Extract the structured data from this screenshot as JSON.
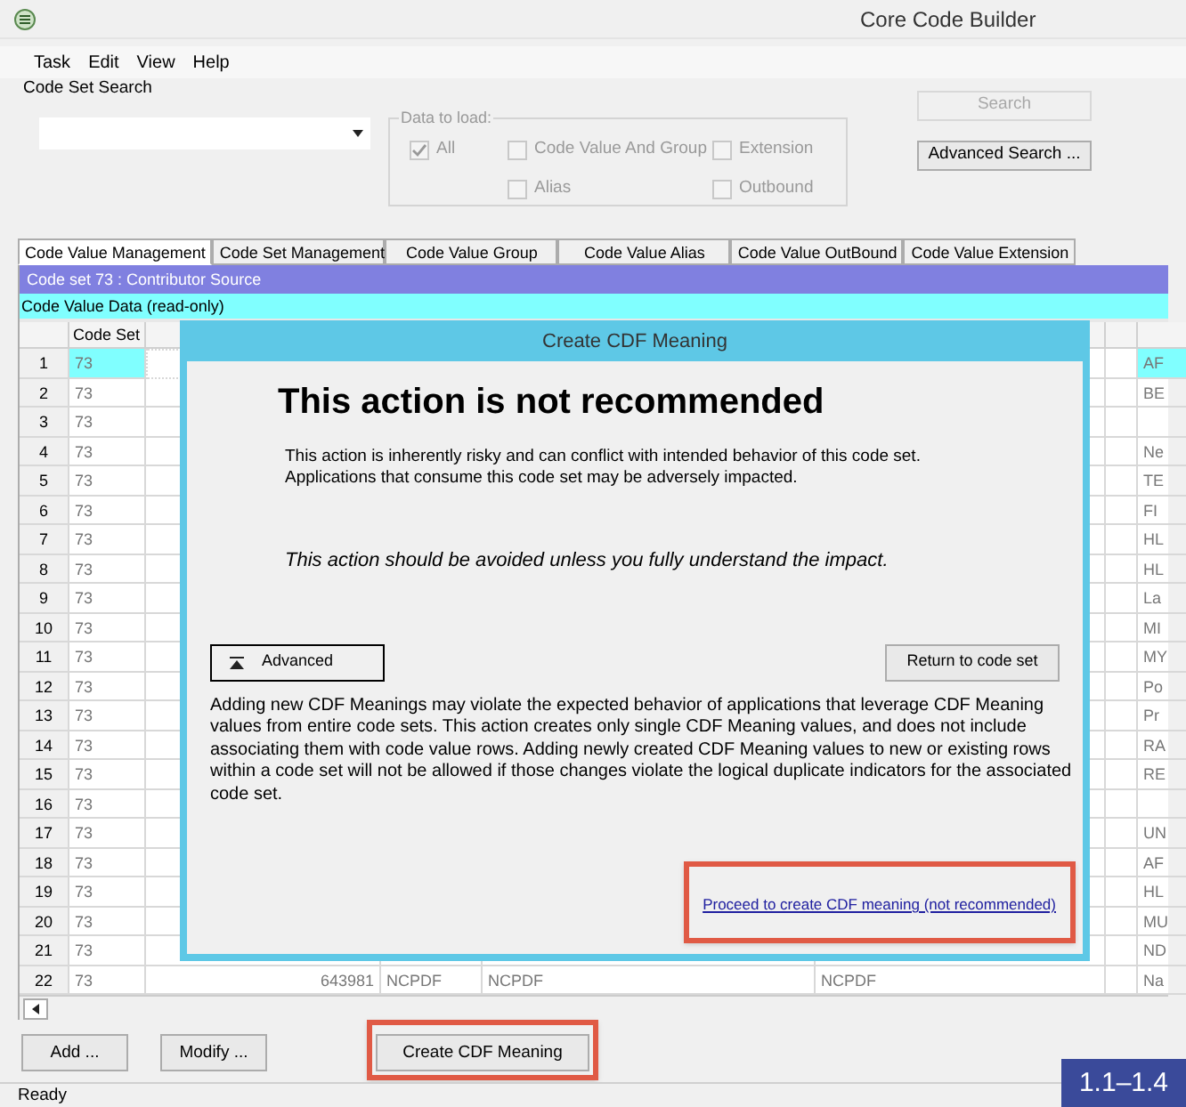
{
  "window": {
    "title": "Core Code Builder"
  },
  "menu": [
    "Task",
    "Edit",
    "View",
    "Help"
  ],
  "search": {
    "label": "Code Set Search",
    "data_to_load": {
      "label": "Data to load:",
      "options": [
        {
          "label": "All",
          "checked": true,
          "disabled": true
        },
        {
          "label": "Code Value And Group",
          "checked": false,
          "disabled": true
        },
        {
          "label": "Extension",
          "checked": false,
          "disabled": true
        },
        {
          "label": "Alias",
          "checked": false,
          "disabled": true
        },
        {
          "label": "Outbound",
          "checked": false,
          "disabled": true
        }
      ]
    },
    "buttons": [
      {
        "label": "Search",
        "disabled": true
      },
      {
        "label": "Advanced Search ...",
        "disabled": false
      }
    ]
  },
  "tabs": [
    {
      "label": "Code Value Management",
      "selected": true
    },
    {
      "label": "Code Set Management",
      "selected": false
    },
    {
      "label": "Code Value Group",
      "selected": false
    },
    {
      "label": "Code Value Alias",
      "selected": false
    },
    {
      "label": "Code Value OutBound",
      "selected": false
    },
    {
      "label": "Code Value Extension",
      "selected": false
    }
  ],
  "code_set_bar": "Code set 73 : Contributor Source",
  "data_bar": "Code Value Data (read-only)",
  "grid": {
    "columns": [
      "Code Set"
    ],
    "rows": [
      {
        "num": "1",
        "code_set": "73",
        "column_8": "AF",
        "selected": true
      },
      {
        "num": "2",
        "code_set": "73",
        "column_8": "BE",
        "selected": false
      },
      {
        "num": "3",
        "code_set": "73",
        "selected": false
      },
      {
        "num": "4",
        "code_set": "73",
        "column_8": "Ne",
        "selected": false
      },
      {
        "num": "5",
        "code_set": "73",
        "column_8": "TE",
        "selected": false
      },
      {
        "num": "6",
        "code_set": "73",
        "column_8": "FI",
        "selected": false
      },
      {
        "num": "7",
        "code_set": "73",
        "column_8": "HL",
        "selected": false
      },
      {
        "num": "8",
        "code_set": "73",
        "column_8": "HL",
        "selected": false
      },
      {
        "num": "9",
        "code_set": "73",
        "column_8": "La",
        "selected": false
      },
      {
        "num": "10",
        "code_set": "73",
        "column_8": "MI",
        "selected": false
      },
      {
        "num": "11",
        "code_set": "73",
        "column_8": "MY",
        "selected": false
      },
      {
        "num": "12",
        "code_set": "73",
        "column_8": "Po",
        "selected": false
      },
      {
        "num": "13",
        "code_set": "73",
        "column_8": "Pr",
        "selected": false
      },
      {
        "num": "14",
        "code_set": "73",
        "column_8": "RA",
        "selected": false
      },
      {
        "num": "15",
        "code_set": "73",
        "column_8": "RE",
        "selected": false
      },
      {
        "num": "16",
        "code_set": "73",
        "selected": false
      },
      {
        "num": "17",
        "code_set": "73",
        "column_8": "UN",
        "selected": false
      },
      {
        "num": "18",
        "code_set": "73",
        "column_8": "AF",
        "selected": false
      },
      {
        "num": "19",
        "code_set": "73",
        "column_8": "HL",
        "selected": false
      },
      {
        "num": "20",
        "code_set": "73",
        "column_8": "MU",
        "selected": false
      },
      {
        "num": "21",
        "code_set": "73",
        "column_8": "ND",
        "selected": false
      },
      {
        "num": "22",
        "code_set": "73",
        "column_3": "643981",
        "column_4": "NCPDF",
        "column_5": "NCPDF",
        "column_6": "NCPDF",
        "column_8": "Na",
        "selected": false
      }
    ]
  },
  "dialog": {
    "title": "Create CDF Meaning",
    "heading": "This action is not recommended",
    "warning": "This action is inherently risky and can conflict with intended behavior of this code set. Applications that consume this code set may be adversely impacted.",
    "caution": "This action should be avoided unless you fully understand the impact.",
    "advanced_button": "Advanced",
    "return_button": "Return to code set",
    "details": "Adding new CDF Meanings may violate the expected behavior of applications that leverage CDF Meaning values from entire code sets.  This action creates only single CDF Meaning values, and does not include associating them with code value rows.  Adding newly created CDF Meaning values to new or existing rows within a code set will not be allowed if those changes violate the logical duplicate indicators for the associated code set.",
    "proceed_link": "Proceed to create CDF meaning (not recommended)",
    "proceed_highlighted": true
  },
  "bottom_buttons": [
    {
      "label": "Add ...",
      "highlighted": false
    },
    {
      "label": "Modify ...",
      "highlighted": false
    },
    {
      "label": "Create CDF Meaning",
      "highlighted": true
    }
  ],
  "status_bar": "Ready",
  "step_badge": "1.1–1.4"
}
